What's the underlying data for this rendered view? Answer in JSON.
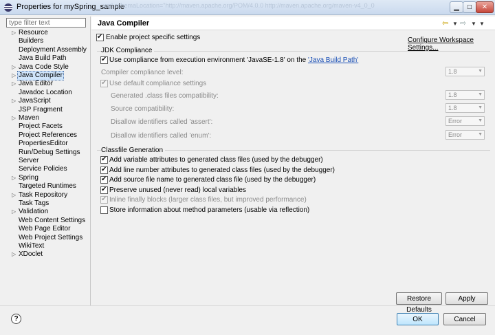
{
  "window": {
    "title": "Properties for mySpring_sample",
    "blurred_background_text": "xml schemaLocation=\"http://maven.apache.org/POM/4.0.0 http://maven.apache.org/maven-v4_0_0"
  },
  "filter": {
    "placeholder": "type filter text"
  },
  "tree": {
    "items": [
      {
        "label": "Resource",
        "expandable": true
      },
      {
        "label": "Builders",
        "expandable": false
      },
      {
        "label": "Deployment Assembly",
        "expandable": false
      },
      {
        "label": "Java Build Path",
        "expandable": false
      },
      {
        "label": "Java Code Style",
        "expandable": true
      },
      {
        "label": "Java Compiler",
        "expandable": true,
        "selected": true
      },
      {
        "label": "Java Editor",
        "expandable": true
      },
      {
        "label": "Javadoc Location",
        "expandable": false
      },
      {
        "label": "JavaScript",
        "expandable": true
      },
      {
        "label": "JSP Fragment",
        "expandable": false
      },
      {
        "label": "Maven",
        "expandable": true
      },
      {
        "label": "Project Facets",
        "expandable": false
      },
      {
        "label": "Project References",
        "expandable": false
      },
      {
        "label": "PropertiesEditor",
        "expandable": false
      },
      {
        "label": "Run/Debug Settings",
        "expandable": false
      },
      {
        "label": "Server",
        "expandable": false
      },
      {
        "label": "Service Policies",
        "expandable": false
      },
      {
        "label": "Spring",
        "expandable": true
      },
      {
        "label": "Targeted Runtimes",
        "expandable": false
      },
      {
        "label": "Task Repository",
        "expandable": true
      },
      {
        "label": "Task Tags",
        "expandable": false
      },
      {
        "label": "Validation",
        "expandable": true
      },
      {
        "label": "Web Content Settings",
        "expandable": false
      },
      {
        "label": "Web Page Editor",
        "expandable": false
      },
      {
        "label": "Web Project Settings",
        "expandable": false
      },
      {
        "label": "WikiText",
        "expandable": false
      },
      {
        "label": "XDoclet",
        "expandable": true
      }
    ]
  },
  "page": {
    "title": "Java Compiler",
    "enable_project_specific": "Enable project specific settings",
    "configure_workspace": "Configure Workspace Settings...",
    "jdk": {
      "group_title": "JDK Compliance",
      "use_compliance_prefix": "Use compliance from execution environment 'JavaSE-1.8' on the ",
      "use_compliance_link": "'Java Build Path'",
      "compiler_level_label": "Compiler compliance level:",
      "compiler_level_value": "1.8",
      "use_default": "Use default compliance settings",
      "generated_label": "Generated .class files compatibility:",
      "generated_value": "1.8",
      "source_label": "Source compatibility:",
      "source_value": "1.8",
      "assert_label": "Disallow identifiers called 'assert':",
      "assert_value": "Error",
      "enum_label": "Disallow identifiers called 'enum':",
      "enum_value": "Error"
    },
    "classfile": {
      "group_title": "Classfile Generation",
      "options": [
        {
          "label": "Add variable attributes to generated class files (used by the debugger)",
          "checked": true,
          "enabled": true
        },
        {
          "label": "Add line number attributes to generated class files (used by the debugger)",
          "checked": true,
          "enabled": true
        },
        {
          "label": "Add source file name to generated class file (used by the debugger)",
          "checked": true,
          "enabled": true
        },
        {
          "label": "Preserve unused (never read) local variables",
          "checked": true,
          "enabled": true
        },
        {
          "label": "Inline finally blocks (larger class files, but improved performance)",
          "checked": true,
          "enabled": false
        },
        {
          "label": "Store information about method parameters (usable via reflection)",
          "checked": false,
          "enabled": true
        }
      ]
    }
  },
  "buttons": {
    "restore_defaults": "Restore Defaults",
    "apply": "Apply",
    "ok": "OK",
    "cancel": "Cancel",
    "help": "?"
  },
  "icons": {
    "app": "eclipse-icon",
    "back": "back-arrow-icon",
    "forward": "forward-arrow-icon",
    "help": "help-icon"
  }
}
